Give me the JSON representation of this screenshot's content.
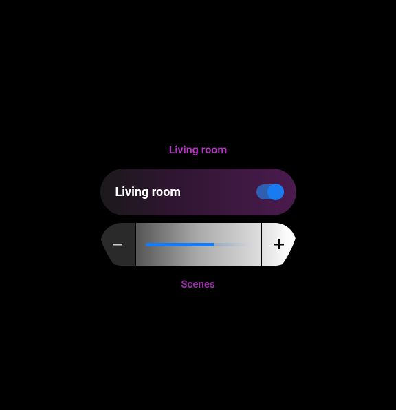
{
  "header": {
    "title": "Living room"
  },
  "card": {
    "label": "Living room",
    "toggle_on": true
  },
  "slider": {
    "value_percent": 65
  },
  "footer": {
    "scenes_label": "Scenes"
  },
  "icons": {
    "minus": "minus-icon",
    "plus": "plus-icon"
  },
  "colors": {
    "accent": "#b935c9",
    "toggle_on": "#1a7bf0"
  }
}
